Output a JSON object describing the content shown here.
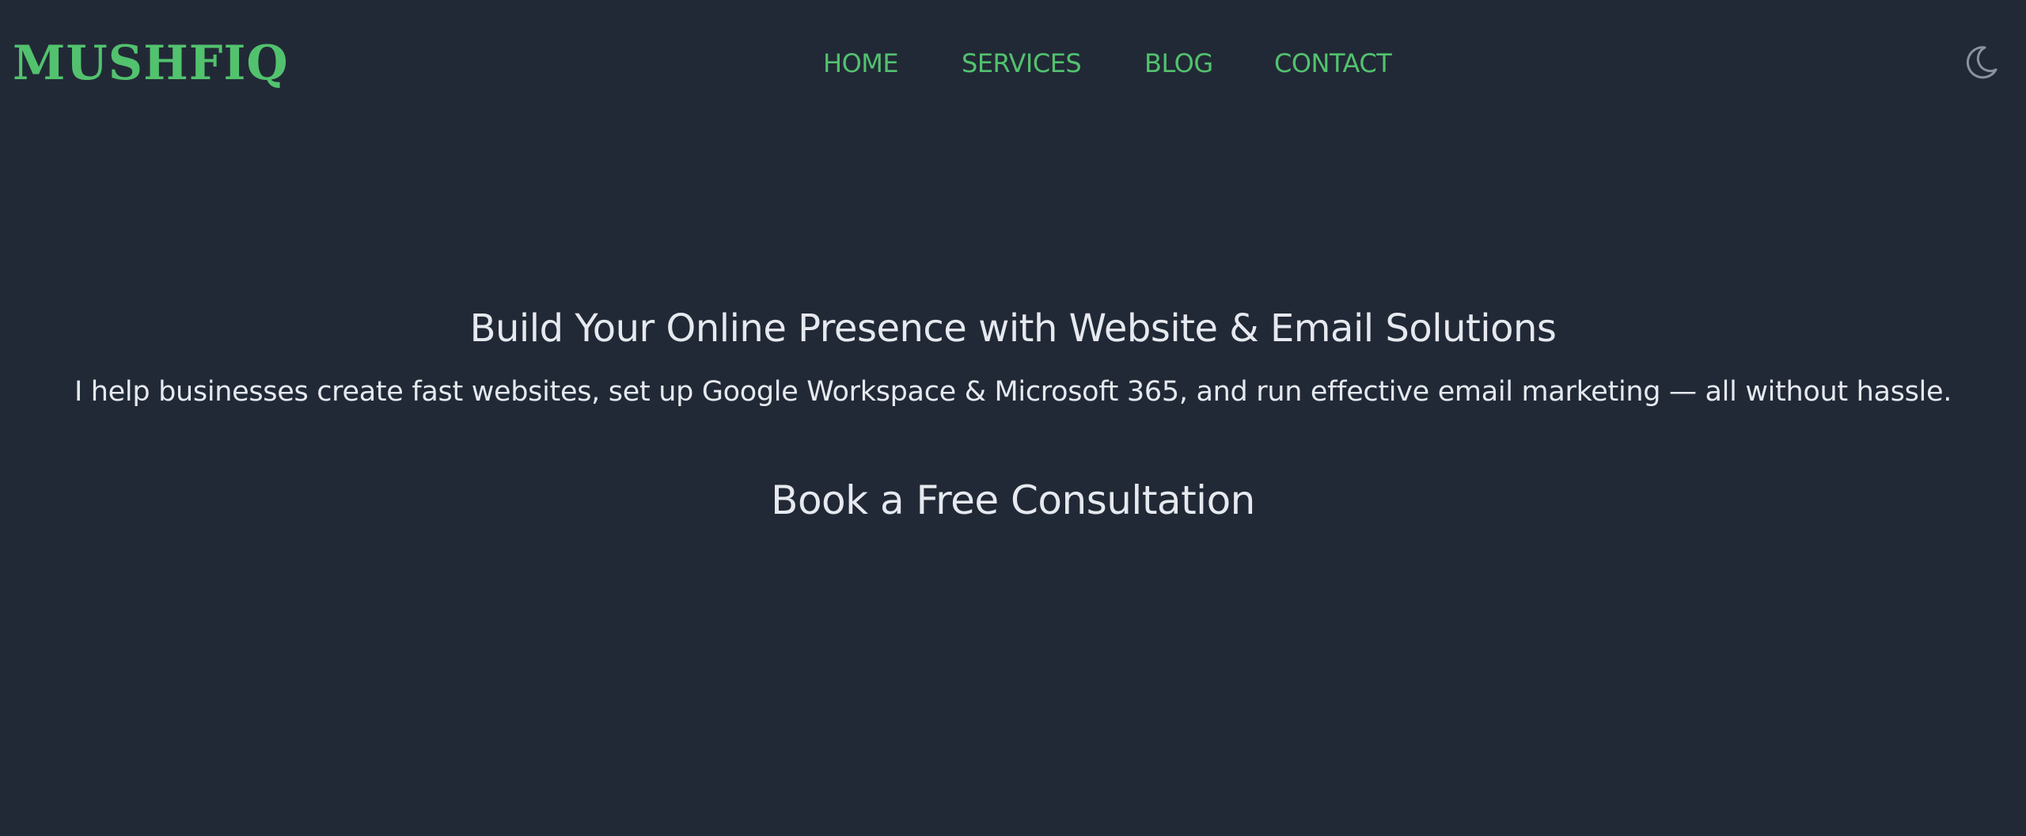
{
  "header": {
    "logo": "MUSHFIQ",
    "nav": [
      {
        "label": "HOME"
      },
      {
        "label": "SERVICES"
      },
      {
        "label": "BLOG"
      },
      {
        "label": "CONTACT"
      }
    ],
    "theme_toggle_icon": "moon-icon"
  },
  "hero": {
    "title": "Build Your Online Presence with Website & Email Solutions",
    "subtitle": "I help businesses create fast websites, set up Google Workspace & Microsoft 365, and run effective email marketing — all without hassle.",
    "cta_label": "Book a Free Consultation"
  },
  "colors": {
    "background": "#222936",
    "accent": "#52c26e",
    "text": "#e6e9ef",
    "icon": "#8b929e"
  }
}
